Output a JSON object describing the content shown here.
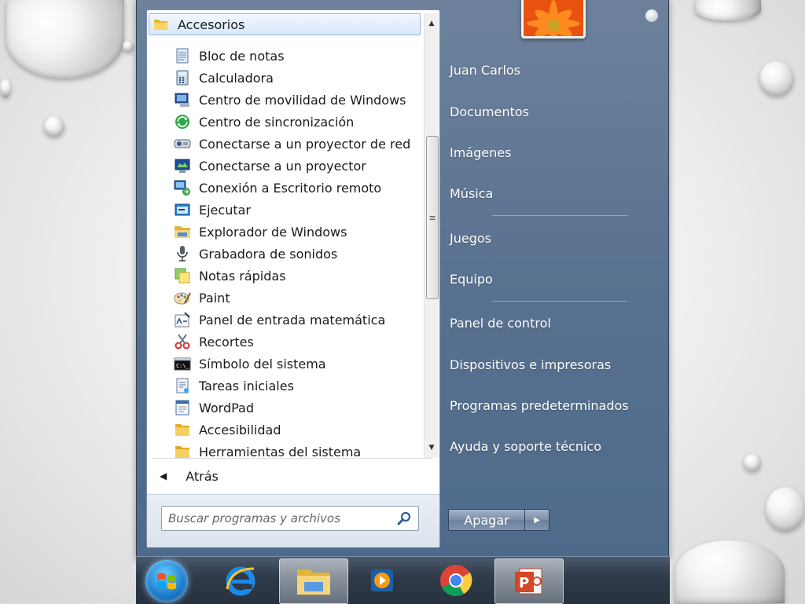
{
  "programs": {
    "folder_title": "Accesorios",
    "items": [
      {
        "label": "Bloc de notas",
        "icon": "notepad-icon"
      },
      {
        "label": "Calculadora",
        "icon": "calculator-icon"
      },
      {
        "label": "Centro de movilidad de Windows",
        "icon": "mobility-center-icon"
      },
      {
        "label": "Centro de sincronización",
        "icon": "sync-center-icon"
      },
      {
        "label": "Conectarse a un proyector de red",
        "icon": "network-projector-icon"
      },
      {
        "label": "Conectarse a un proyector",
        "icon": "projector-icon"
      },
      {
        "label": "Conexión a Escritorio remoto",
        "icon": "remote-desktop-icon"
      },
      {
        "label": "Ejecutar",
        "icon": "run-icon"
      },
      {
        "label": "Explorador de Windows",
        "icon": "explorer-icon"
      },
      {
        "label": "Grabadora de sonidos",
        "icon": "microphone-icon"
      },
      {
        "label": "Notas rápidas",
        "icon": "sticky-notes-icon"
      },
      {
        "label": "Paint",
        "icon": "paint-icon"
      },
      {
        "label": "Panel de entrada matemática",
        "icon": "math-input-icon"
      },
      {
        "label": "Recortes",
        "icon": "snipping-tool-icon"
      },
      {
        "label": "Símbolo del sistema",
        "icon": "command-prompt-icon"
      },
      {
        "label": "Tareas iniciales",
        "icon": "getting-started-icon"
      },
      {
        "label": "WordPad",
        "icon": "wordpad-icon"
      },
      {
        "label": "Accesibilidad",
        "icon": "folder-icon"
      },
      {
        "label": "Herramientas del sistema",
        "icon": "folder-icon"
      }
    ],
    "back_label": "Atrás"
  },
  "search": {
    "placeholder": "Buscar programas y archivos"
  },
  "right_pane": {
    "items": [
      {
        "label": "Juan Carlos"
      },
      {
        "label": "Documentos"
      },
      {
        "label": "Imágenes"
      },
      {
        "label": "Música"
      },
      {
        "label": "Juegos"
      },
      {
        "label": "Equipo"
      },
      {
        "label": "Panel de control"
      },
      {
        "label": "Dispositivos e impresoras"
      },
      {
        "label": "Programas predeterminados"
      },
      {
        "label": "Ayuda y soporte técnico"
      }
    ]
  },
  "shutdown": {
    "label": "Apagar"
  },
  "taskbar": {
    "items": [
      {
        "icon": "internet-explorer-icon"
      },
      {
        "icon": "windows-explorer-icon",
        "active": true
      },
      {
        "icon": "media-player-icon"
      },
      {
        "icon": "chrome-icon"
      },
      {
        "icon": "powerpoint-icon",
        "active": true
      }
    ]
  },
  "colors": {
    "menu_blue": "#57708f",
    "highlight": "#d8e8fb",
    "taskbar": "#2f3b4a"
  }
}
